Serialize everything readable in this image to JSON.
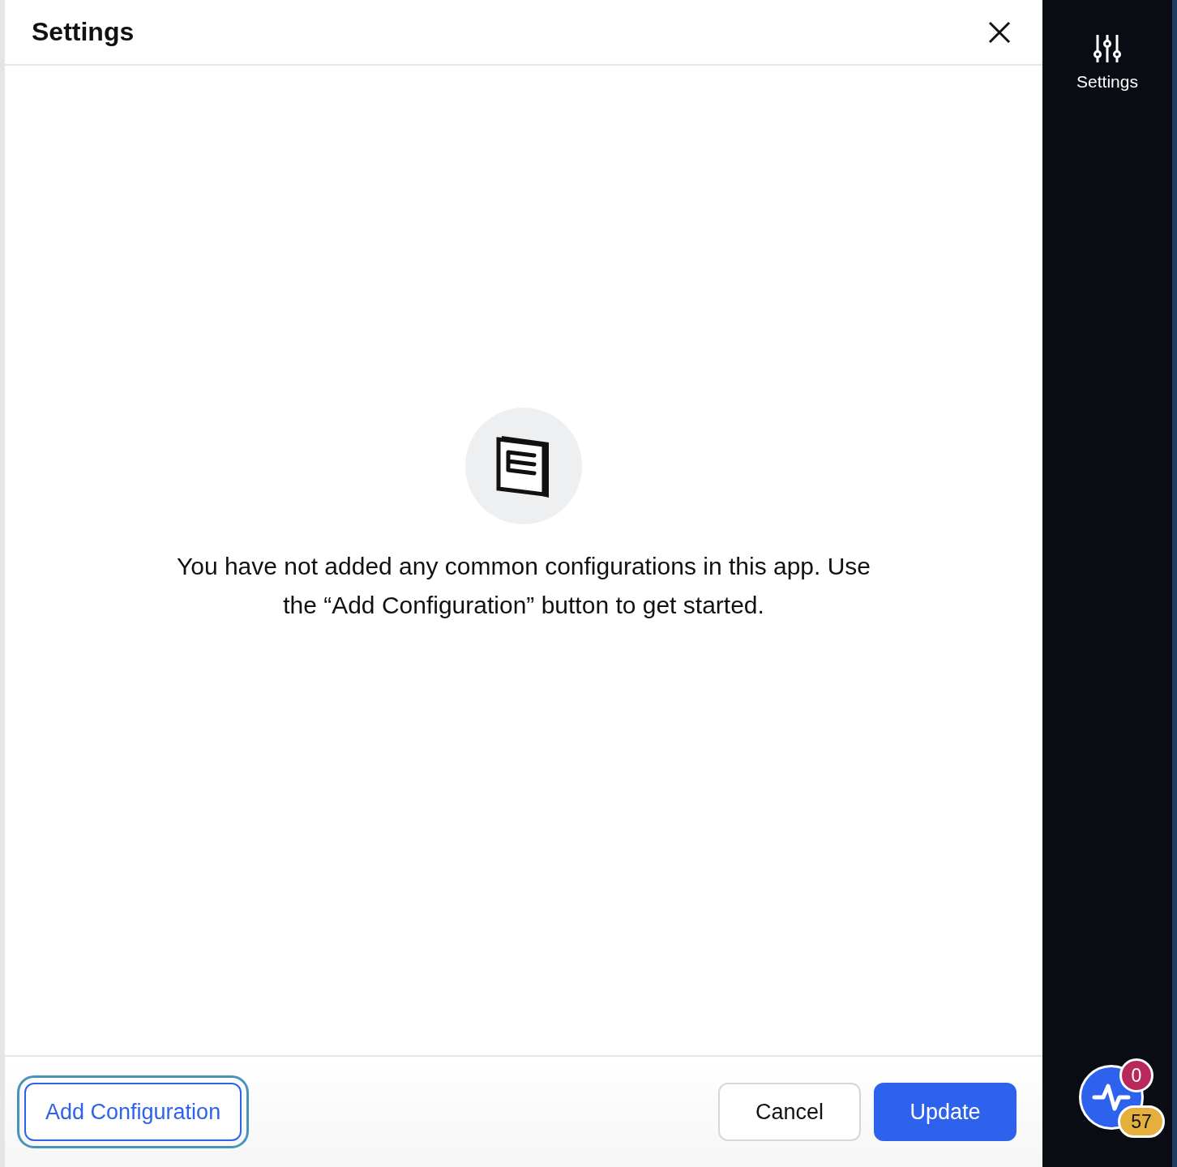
{
  "panel": {
    "title": "Settings"
  },
  "empty_state": {
    "message": "You have not added any common configurations in this app. Use the “Add Configuration” button to get started."
  },
  "footer": {
    "buttons": [
      {
        "label": "Add Configuration",
        "kind": "outline",
        "focused": true
      },
      {
        "label": "Cancel",
        "kind": "secondary",
        "focused": false
      },
      {
        "label": "Update",
        "kind": "primary",
        "focused": false
      }
    ]
  },
  "sidebar": {
    "items": [
      {
        "label": "Settings"
      }
    ]
  },
  "activity_widget": {
    "alerts": "0",
    "count": "57"
  }
}
